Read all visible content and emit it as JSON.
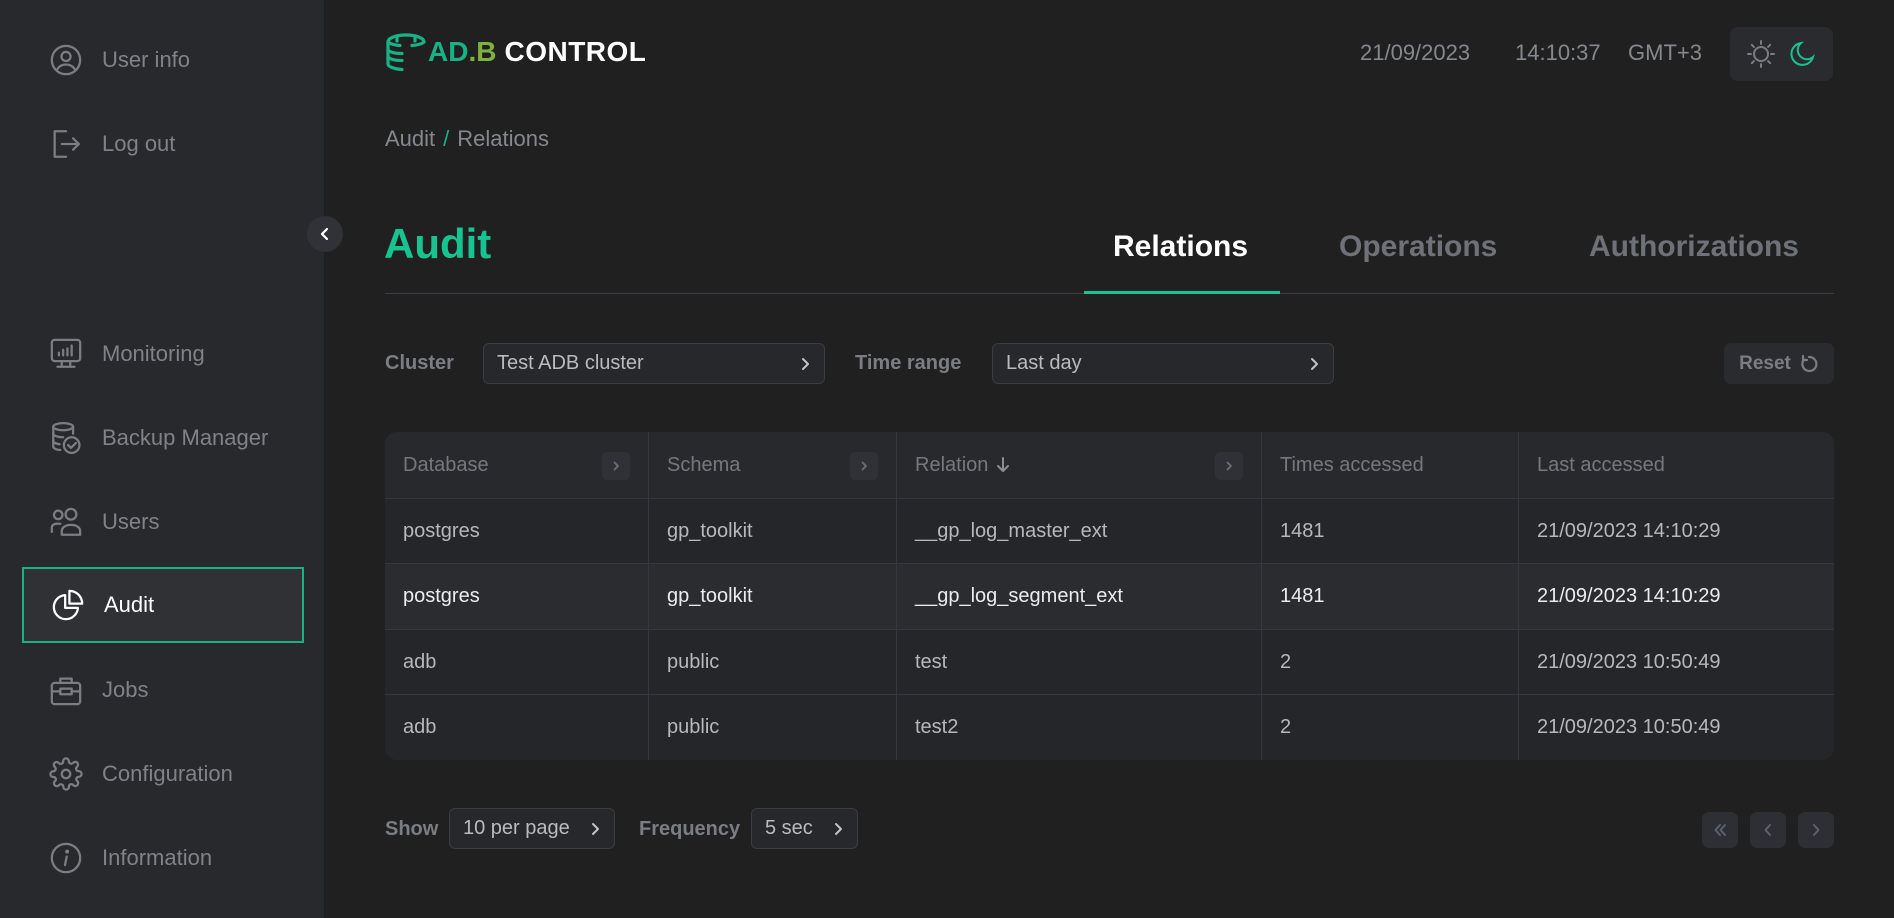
{
  "sidebar": {
    "top_items": [
      {
        "label": "User info",
        "icon": "user-circle-icon"
      },
      {
        "label": "Log out",
        "icon": "logout-icon"
      }
    ],
    "nav_items": [
      {
        "label": "Monitoring",
        "icon": "monitor-chart-icon"
      },
      {
        "label": "Backup Manager",
        "icon": "database-backup-icon"
      },
      {
        "label": "Users",
        "icon": "users-icon"
      },
      {
        "label": "Audit",
        "icon": "pie-chart-icon",
        "active": true
      },
      {
        "label": "Jobs",
        "icon": "briefcase-icon"
      },
      {
        "label": "Configuration",
        "icon": "gear-icon"
      },
      {
        "label": "Information",
        "icon": "info-icon"
      }
    ],
    "collapse_icon": "chevron-left-icon"
  },
  "header": {
    "logo": {
      "part1": "AD",
      "dot": ".",
      "part2": "B",
      "part3": "CONTROL"
    },
    "date": "21/09/2023",
    "time": "14:10:37",
    "timezone": "GMT+3",
    "theme": {
      "light_icon": "sun-icon",
      "dark_icon": "moon-icon",
      "active": "dark"
    }
  },
  "breadcrumb": {
    "items": [
      "Audit",
      "Relations"
    ],
    "separator": "/"
  },
  "page": {
    "title": "Audit",
    "tabs": [
      {
        "label": "Relations",
        "active": true
      },
      {
        "label": "Operations",
        "active": false
      },
      {
        "label": "Authorizations",
        "active": false
      }
    ]
  },
  "filters": {
    "cluster_label": "Cluster",
    "cluster_value": "Test ADB cluster",
    "time_range_label": "Time range",
    "time_range_value": "Last day",
    "reset_label": "Reset"
  },
  "table": {
    "columns": [
      "Database",
      "Schema",
      "Relation",
      "Times accessed",
      "Last accessed"
    ],
    "sorted_column": "Relation",
    "sort_direction": "desc",
    "rows": [
      [
        "postgres",
        "gp_toolkit",
        "__gp_log_master_ext",
        "1481",
        "21/09/2023 14:10:29"
      ],
      [
        "postgres",
        "gp_toolkit",
        "__gp_log_segment_ext",
        "1481",
        "21/09/2023 14:10:29"
      ],
      [
        "adb",
        "public",
        "test",
        "2",
        "21/09/2023 10:50:49"
      ],
      [
        "adb",
        "public",
        "test2",
        "2",
        "21/09/2023 10:50:49"
      ]
    ]
  },
  "footer": {
    "show_label": "Show",
    "show_value": "10 per page",
    "frequency_label": "Frequency",
    "frequency_value": "5 sec",
    "pagination": [
      "first-page-icon",
      "prev-page-icon",
      "next-page-icon"
    ]
  },
  "colors": {
    "accent": "#19c391",
    "logo_green": "#7db33c",
    "sidebar_bg": "#28292d",
    "page_bg": "#202020"
  }
}
